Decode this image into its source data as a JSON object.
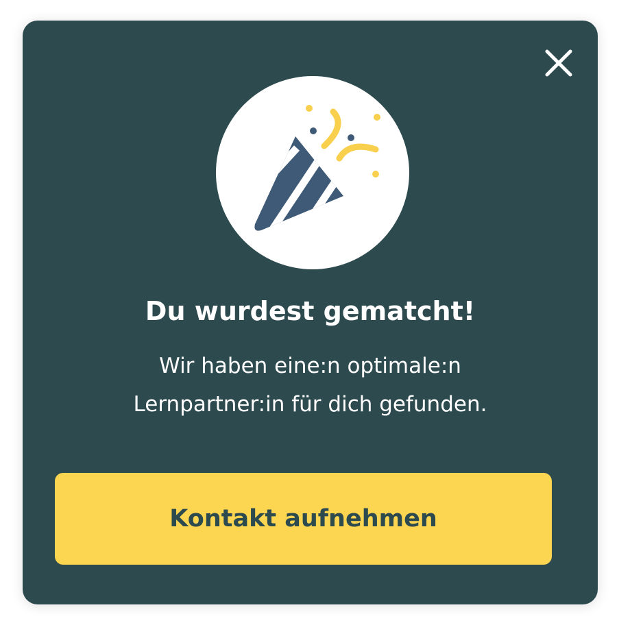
{
  "dialog": {
    "close_icon": "close-icon",
    "hero_icon": "party-popper-icon",
    "title": "Du wurdest gematcht!",
    "message": "Wir haben eine:n optimale:n Lernpartner:in für dich gefunden.",
    "cta_label": "Kontakt aufnehmen"
  },
  "colors": {
    "background": "#2d4a4f",
    "accent": "#fcd650",
    "icon_cone": "#3f5a77",
    "text": "#ffffff"
  }
}
